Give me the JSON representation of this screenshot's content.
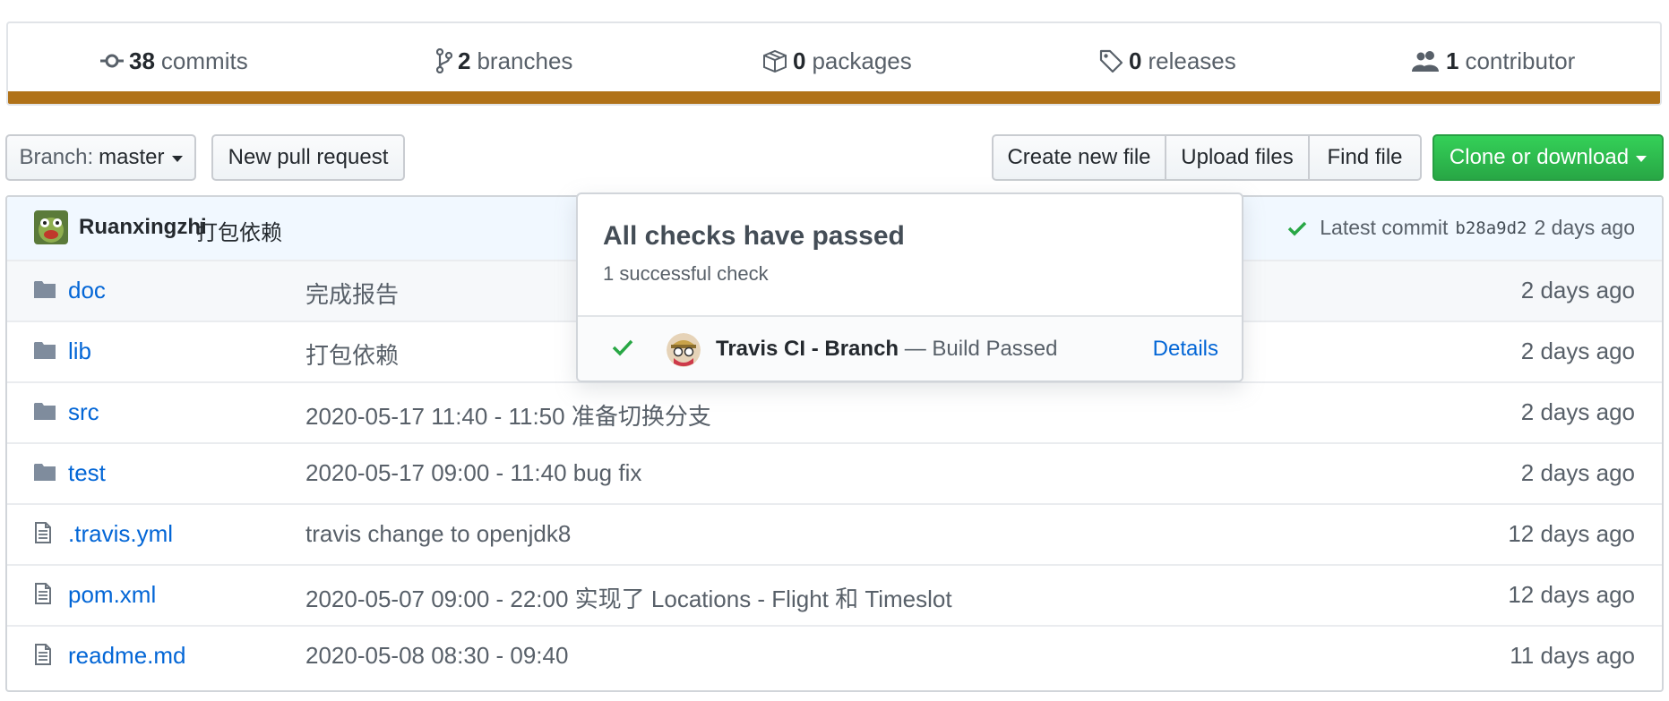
{
  "summary": {
    "commits": {
      "count": "38",
      "label": "commits"
    },
    "branches": {
      "count": "2",
      "label": "branches"
    },
    "packages": {
      "count": "0",
      "label": "packages"
    },
    "releases": {
      "count": "0",
      "label": "releases"
    },
    "contributors": {
      "count": "1",
      "label": "contributor"
    },
    "language_color": "#b07219"
  },
  "toolbar": {
    "branch_prefix": "Branch:",
    "branch_name": "master",
    "new_pr": "New pull request",
    "create_file": "Create new file",
    "upload_files": "Upload files",
    "find_file": "Find file",
    "clone": "Clone or download"
  },
  "latest_commit": {
    "author": "Ruanxingzhi",
    "message": "打包依赖",
    "label": "Latest commit",
    "sha": "b28a9d2",
    "age": "2 days ago"
  },
  "files": [
    {
      "type": "folder",
      "name": "doc",
      "message": "完成报告",
      "age": "2 days ago"
    },
    {
      "type": "folder",
      "name": "lib",
      "message": "打包依赖",
      "age": "2 days ago"
    },
    {
      "type": "folder",
      "name": "src",
      "message": "2020-05-17 11:40 - 11:50 准备切换分支",
      "age": "2 days ago"
    },
    {
      "type": "folder",
      "name": "test",
      "message": "2020-05-17 09:00 - 11:40 bug fix",
      "age": "2 days ago"
    },
    {
      "type": "file",
      "name": ".travis.yml",
      "message": "travis change to openjdk8",
      "age": "12 days ago"
    },
    {
      "type": "file",
      "name": "pom.xml",
      "message": "2020-05-07 09:00 - 22:00 实现了 Locations - Flight 和 Timeslot",
      "age": "12 days ago"
    },
    {
      "type": "file",
      "name": "readme.md",
      "message": "2020-05-08 08:30 - 09:40",
      "age": "11 days ago"
    }
  ],
  "checks_popover": {
    "title": "All checks have passed",
    "subtitle": "1 successful check",
    "check_name": "Travis CI - Branch",
    "check_status": "— Build Passed",
    "details": "Details"
  }
}
